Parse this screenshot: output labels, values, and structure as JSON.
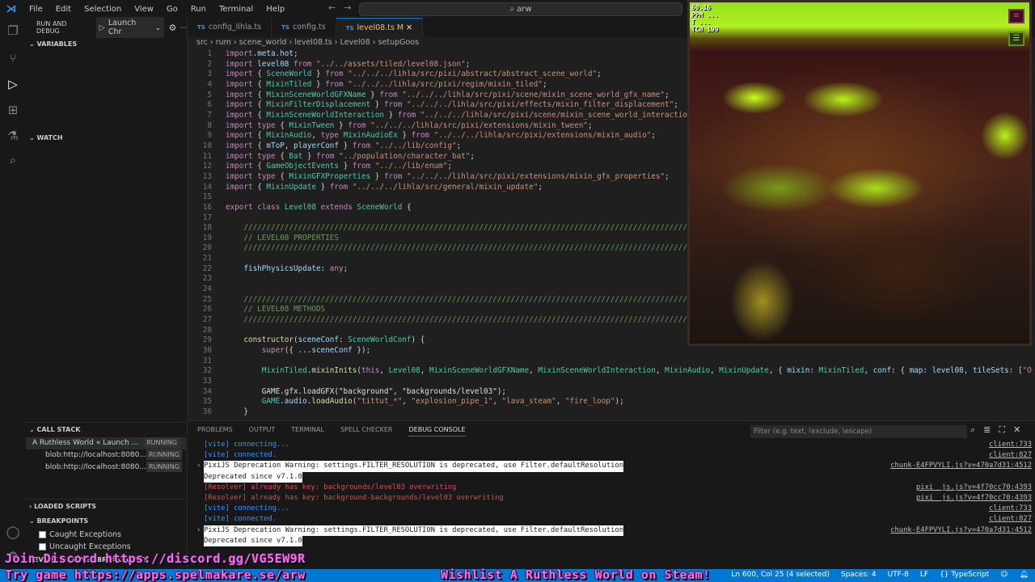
{
  "menu": [
    "File",
    "Edit",
    "Selection",
    "View",
    "Go",
    "Run",
    "Terminal",
    "Help"
  ],
  "command_center": "arw",
  "sidebar": {
    "title": "RUN AND DEBUG",
    "launch": "Launch Chr",
    "variables": "VARIABLES",
    "watch": "WATCH",
    "call_stack": "CALL STACK",
    "stack": [
      {
        "label": "A Ruthless World « Launch ...",
        "state": "RUNNING"
      },
      {
        "label": "blob:http://localhost:8080...",
        "state": "RUNNING"
      },
      {
        "label": "blob:http://localhost:8080...",
        "state": "RUNNING"
      }
    ],
    "loaded_scripts": "LOADED SCRIPTS",
    "breakpoints": "BREAKPOINTS",
    "bp_items": [
      "Caught Exceptions",
      "Uncaught Exceptions"
    ],
    "event_bp": "EVENT LISTENER BREAKPOINTS"
  },
  "tabs": [
    {
      "label": "config_lihla.ts"
    },
    {
      "label": "config.ts"
    },
    {
      "label": "level08.ts M"
    }
  ],
  "breadcrumb": "src › rum › scene_world › level08.ts › Level08 › setupGoos",
  "code": [
    "import.meta.hot;",
    "import level08 from \"../../assets/tiled/level08.json\";",
    "import { SceneWorld } from \"../../../lihla/src/pixi/abstract/abstract_scene_world\";",
    "import { MixinTiled } from \"../../../lihla/src/pixi/regim/mixin_tiled\";",
    "import { MixinSceneWorldGFXName } from \"../../../lihla/src/pixi/scene/mixin_scene_world_gfx_name\";",
    "import { MixinFilterDisplacement } from \"../../../lihla/src/pixi/effects/mixin_filter_displacement\";",
    "import { MixinSceneWorldInteraction } from \"../../../lihla/src/pixi/scene/mixin_scene_world_interaction\";",
    "import type { MixinTween } from \"../../../lihla/src/pixi/extensions/mixin_tween\";",
    "import { MixinAudio, type MixinAudioEx } from \"../../../lihla/src/pixi/extensions/mixin_audio\";",
    "import { mToP, playerConf } from \"../../lib/config\";",
    "import type { Bat } from \"../population/character_bat\";",
    "import { GameObjectEvents } from \"../../lib/enum\";",
    "import type { MixinGFXProperties } from \"../../../lihla/src/pixi/extensions/mixin_gfx_properties\";",
    "import { MixinUpdate } from \"../../../lihla/src/general/mixin_update\";",
    "",
    "export class Level08 extends SceneWorld {",
    "",
    "    ////////////////////////////////////////////////////////////////////////////////////////////////////////",
    "    // LEVEL08 PROPERTIES",
    "    ////////////////////////////////////////////////////////////////////////////////////////////////////////",
    "",
    "    fishPhysicsUpdate: any;",
    "",
    "",
    "    ////////////////////////////////////////////////////////////////////////////////////////////////////////",
    "    // LEVEL08 METHODS",
    "    ////////////////////////////////////////////////////////////////////////////////////////////////////////",
    "",
    "    constructor(sceneConf: SceneWorldConf) {",
    "        super({ ...sceneConf });",
    "",
    "        MixinTiled.mixinInits(this, Level08, MixinSceneWorldGFXName, MixinSceneWorldInteraction, MixinAudio, MixinUpdate, { mixin: MixinTiled, conf: { map: level08, tileSets: [\"O",
    "",
    "        GAME.gfx.loadGFX(\"background\", \"backgrounds/level03\");",
    "        GAME.audio.loadAudio(\"tittut_*\", \"explosion_pipe_1\", \"lava_steam\", \"fire_loop\");",
    "    }"
  ],
  "game": {
    "hud": [
      "60.16",
      "PPM ...",
      "T ...",
      "TCH 199"
    ]
  },
  "panel": {
    "tabs": [
      "PROBLEMS",
      "OUTPUT",
      "TERMINAL",
      "SPELL CHECKER",
      "DEBUG CONSOLE"
    ],
    "filter_placeholder": "Filter (e.g. text, !exclude, \\escape)",
    "lines": [
      {
        "kind": "blue",
        "text": "[vite] connecting...",
        "src": "client:733"
      },
      {
        "kind": "blue",
        "text": "[vite] connected.",
        "src": "client:827"
      },
      {
        "kind": "warn",
        "text": "PixiJS Deprecation Warning: settings.FILTER_RESOLUTION is deprecated, use Filter.defaultResolution",
        "src": "chunk-E4FPVYLI.js?v=470a7d31:4512",
        "arrow": true
      },
      {
        "kind": "warn",
        "text": "Deprecated since v7.1.0",
        "src": ""
      },
      {
        "kind": "red",
        "text": "[Resolver] already has key: backgrounds/level03 overwriting",
        "src": "pixi__js.js?v=4f70cc70:4393"
      },
      {
        "kind": "red",
        "text": "[Resolver] already has key: background-backgrounds/level03 overwriting",
        "src": "pixi__js.js?v=4f70cc70:4393"
      },
      {
        "kind": "blue",
        "text": "[vite] connecting...",
        "src": "client:733"
      },
      {
        "kind": "blue",
        "text": "[vite] connected.",
        "src": "client:827"
      },
      {
        "kind": "warn",
        "text": "PixiJS Deprecation Warning: settings.FILTER_RESOLUTION is deprecated, use Filter.defaultResolution",
        "src": "chunk-E4FPVYLI.js?v=470a7d31:4512",
        "arrow": true
      },
      {
        "kind": "warn",
        "text": "Deprecated since v7.1.0",
        "src": ""
      }
    ]
  },
  "status": {
    "position": "Ln 600, Col 25 (4 selected)",
    "spaces": "Spaces: 4",
    "encoding": "UTF-8",
    "eol": "LF",
    "language": "{} TypeScript"
  },
  "overlay": {
    "discord": "Join Discord https://discord.gg/VG5EW9R",
    "try": "Try game https://apps.spelmakare.se/arw",
    "wishlist": "Wishlist A Ruthless World on Steam!"
  }
}
